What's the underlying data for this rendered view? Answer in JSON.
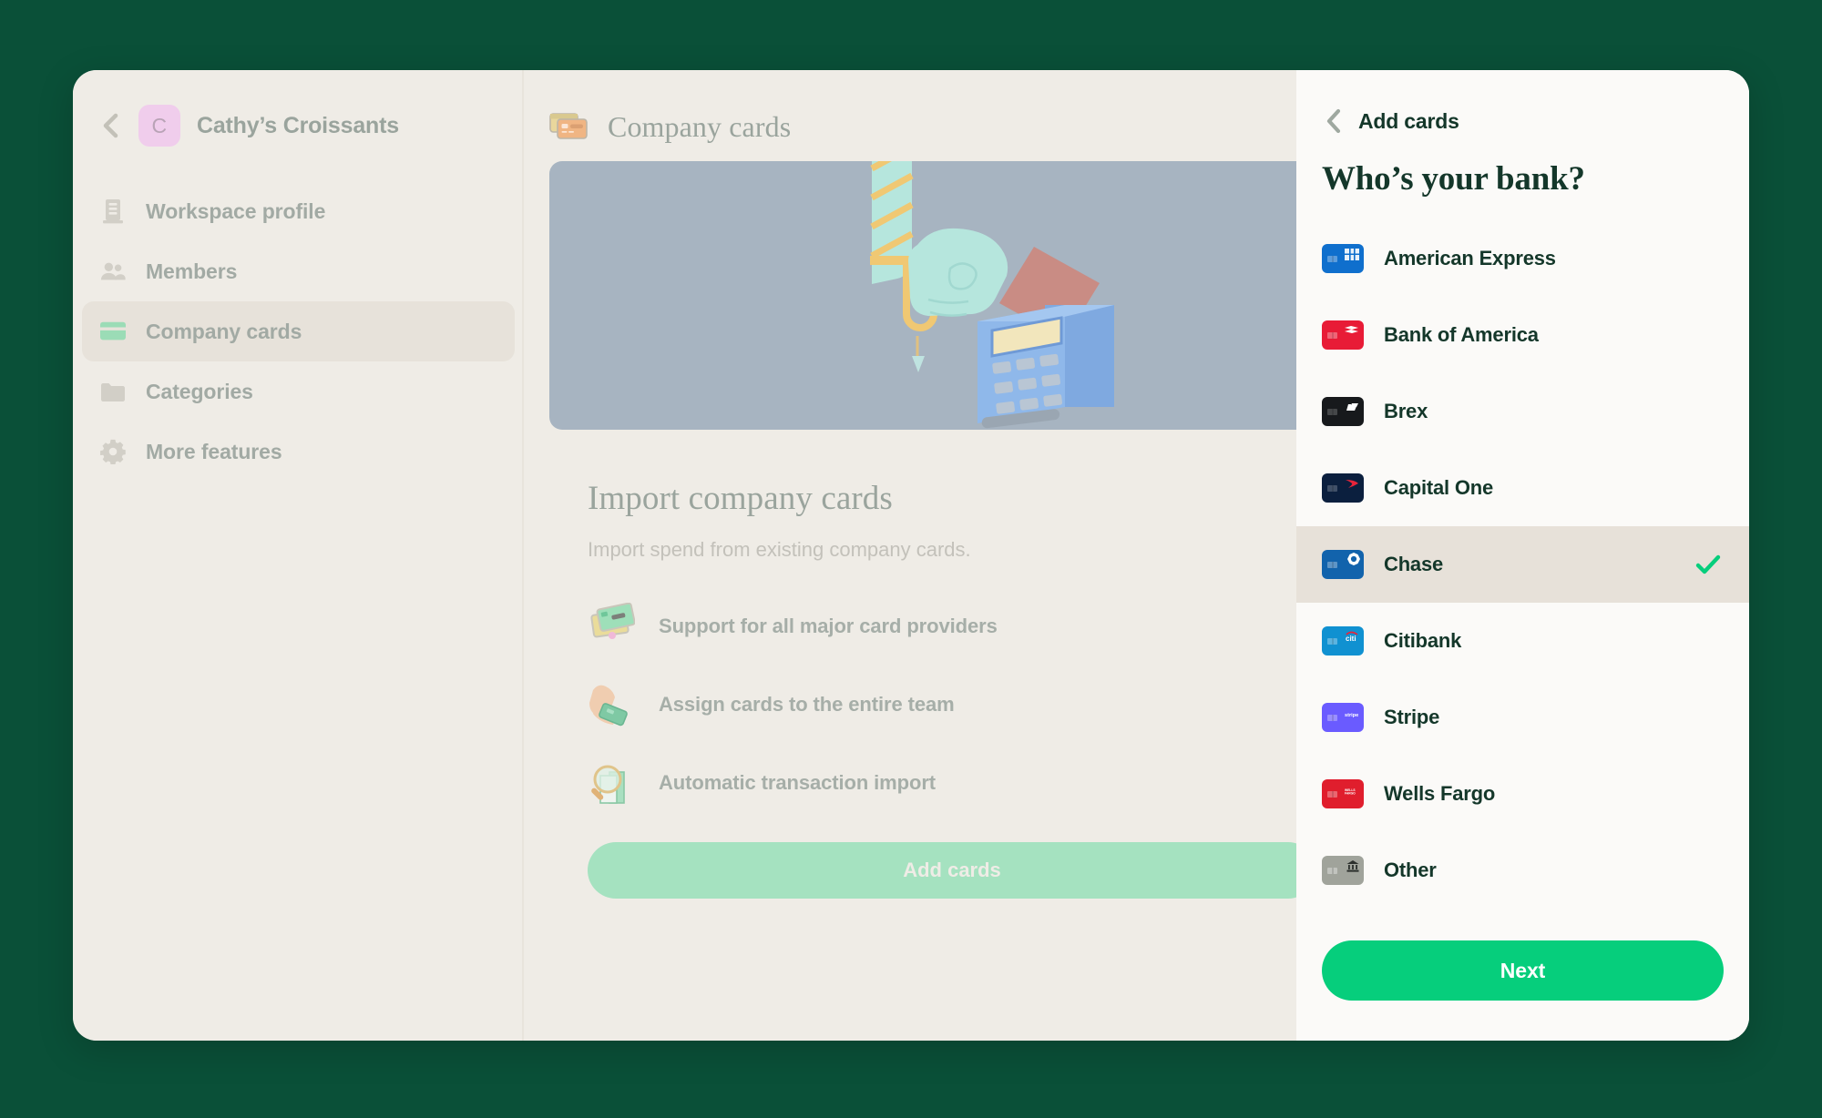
{
  "theme": {
    "page_bg": "#0a5038",
    "window_bg": "#efece6",
    "drawer_bg": "#fbfaf8",
    "selected_row_bg": "#e7e1d9",
    "accent_green": "#06ce7c",
    "muted_text": "#9aa49d",
    "dark_green_text": "#14372a",
    "hero_bg": "#a7b4c1"
  },
  "sidebar": {
    "back_icon": "chevron-left-icon",
    "workspace": {
      "avatar_letter": "C",
      "avatar_color": "#f0cdec",
      "name": "Cathy’s Croissants"
    },
    "items": [
      {
        "label": "Workspace profile",
        "icon": "building-icon",
        "active": false
      },
      {
        "label": "Members",
        "icon": "people-icon",
        "active": false
      },
      {
        "label": "Company cards",
        "icon": "credit-card-icon",
        "active": true
      },
      {
        "label": "Categories",
        "icon": "folder-icon",
        "active": false
      },
      {
        "label": "More features",
        "icon": "gear-icon",
        "active": false
      }
    ]
  },
  "main": {
    "header": {
      "icon": "two-cards-icon",
      "title": "Company cards"
    },
    "hero": {
      "icon": "card-terminal-illustration"
    },
    "body": {
      "title": "Import company cards",
      "subtitle": "Import spend from existing company cards.",
      "features": [
        {
          "label": "Support for all major card providers",
          "icon": "stacked-cards-icon"
        },
        {
          "label": "Assign cards to the entire team",
          "icon": "hand-holding-card-icon"
        },
        {
          "label": "Automatic transaction import",
          "icon": "magnifier-receipt-icon"
        }
      ],
      "add_cards_label": "Add cards"
    }
  },
  "drawer": {
    "back_icon": "chevron-left-icon",
    "title": "Add cards",
    "heading": "Who’s your bank?",
    "banks": [
      {
        "name": "American Express",
        "chip_color": "#0f6fcd",
        "logo": "amex-logo",
        "logo_text": "",
        "selected": false
      },
      {
        "name": "Bank of America",
        "chip_color": "#e81b36",
        "logo": "bofa-logo",
        "logo_text": "",
        "selected": false
      },
      {
        "name": "Brex",
        "chip_color": "#17191c",
        "logo": "brex-logo",
        "logo_text": "",
        "selected": false
      },
      {
        "name": "Capital One",
        "chip_color": "#0b1f3e",
        "logo": "capitalone-logo",
        "logo_text": "",
        "selected": false
      },
      {
        "name": "Chase",
        "chip_color": "#1263ac",
        "logo": "chase-octagon-logo",
        "logo_text": "",
        "selected": true
      },
      {
        "name": "Citibank",
        "chip_color": "#1091d1",
        "logo": "citi-logo",
        "logo_text": "citi",
        "selected": false
      },
      {
        "name": "Stripe",
        "chip_color": "#6a5bff",
        "logo": "stripe-logo",
        "logo_text": "stripe",
        "selected": false
      },
      {
        "name": "Wells Fargo",
        "chip_color": "#e01e2d",
        "logo": "wellsfargo-logo",
        "logo_text": "WELLS FARGO",
        "selected": false
      },
      {
        "name": "Other",
        "chip_color": "#a0a39b",
        "logo": "bank-building-icon",
        "logo_text": "",
        "selected": false
      }
    ],
    "selected_bank": "Chase",
    "check_icon": "check-icon",
    "next_label": "Next"
  }
}
